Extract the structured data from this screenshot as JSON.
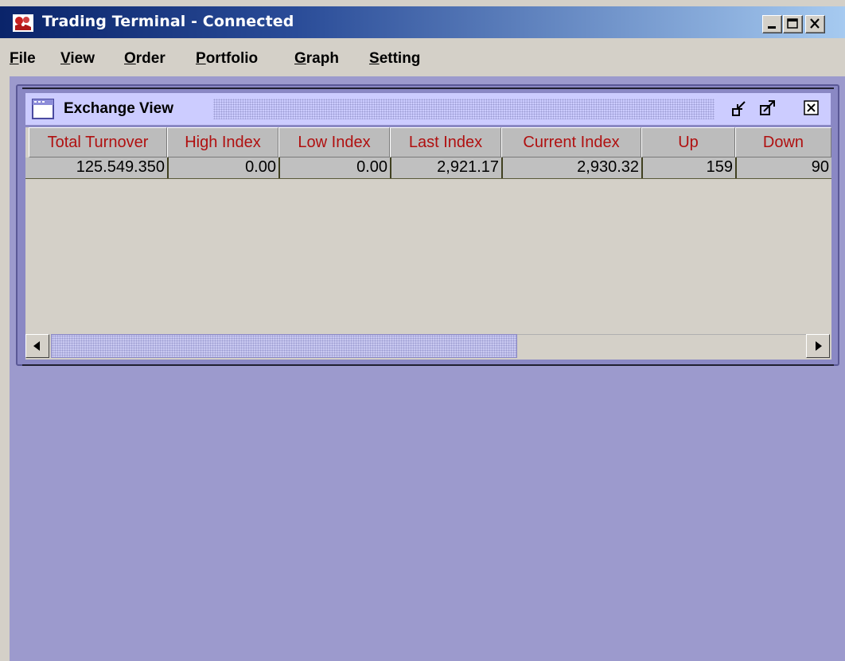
{
  "window": {
    "title": "Trading Terminal - Connected",
    "app_icon": "trading-terminal-logo-icon",
    "controls": [
      "minimize-icon",
      "maximize-icon",
      "close-icon"
    ]
  },
  "menubar": {
    "items": [
      {
        "mnemonic": "F",
        "rest": "ile"
      },
      {
        "mnemonic": "V",
        "rest": "iew"
      },
      {
        "mnemonic": "O",
        "rest": "rder"
      },
      {
        "mnemonic": "P",
        "rest": "ortfolio"
      },
      {
        "mnemonic": "G",
        "rest": "raph"
      },
      {
        "mnemonic": "S",
        "rest": "etting"
      }
    ]
  },
  "exchange_view": {
    "title": "Exchange View",
    "icon": "window-frame-icon",
    "controls": [
      "iconify-icon",
      "maximize-icon",
      "close-icon"
    ],
    "columns": [
      "Total Turnover",
      "High Index",
      "Low Index",
      "Last Index",
      "Current Index",
      "Up",
      "Down"
    ],
    "rows": [
      [
        "125.549.350",
        "0.00",
        "0.00",
        "2,921.17",
        "2,930.32",
        "159",
        "90"
      ]
    ],
    "scrollbar": {
      "left_arrow": "arrow-left-icon",
      "right_arrow": "arrow-right-icon"
    }
  },
  "colors": {
    "desktop": "#9c9acd",
    "frame_title": "#ccccff",
    "header_text": "#b01010",
    "title_gradient_start": "#0a246a",
    "title_gradient_end": "#a6caf0"
  }
}
